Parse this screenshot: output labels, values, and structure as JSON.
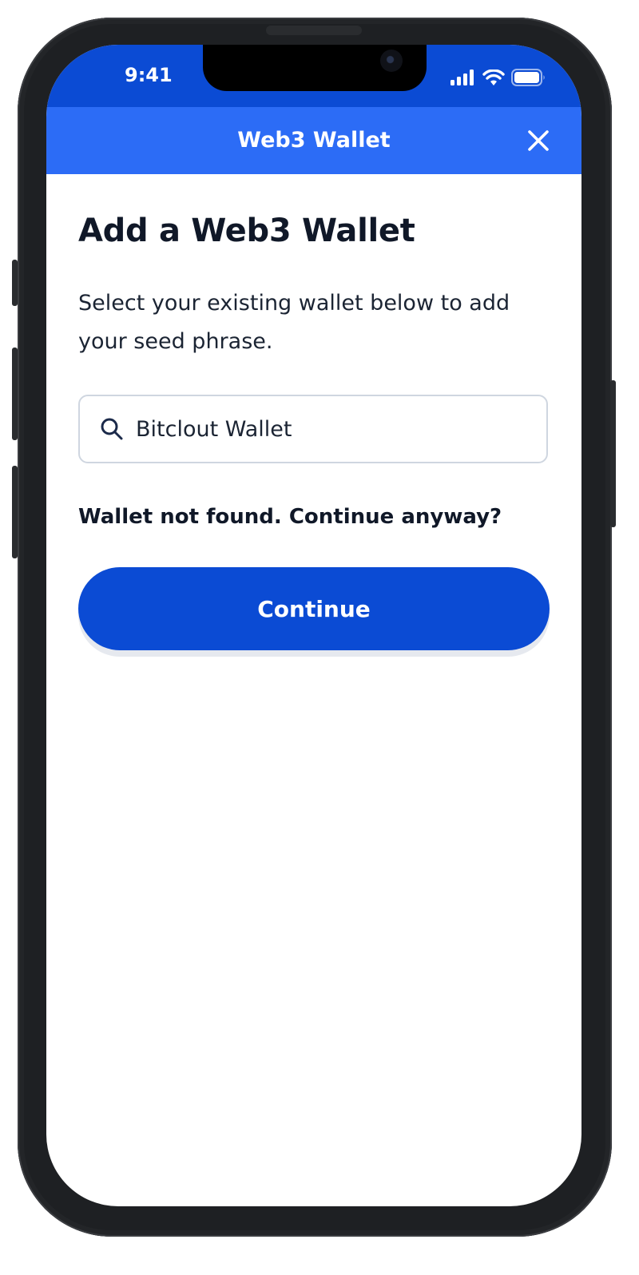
{
  "status_bar": {
    "time": "9:41",
    "icons": [
      "cellular-signal-icon",
      "wifi-icon",
      "battery-icon"
    ]
  },
  "header": {
    "title": "Web3 Wallet",
    "close_icon": "close-icon"
  },
  "main": {
    "heading": "Add a Web3 Wallet",
    "description": "Select your existing wallet below to add your seed phrase.",
    "search": {
      "icon": "search-icon",
      "value": "Bitclout Wallet",
      "placeholder": ""
    },
    "not_found_message": "Wallet not found. Continue anyway?",
    "continue_label": "Continue"
  },
  "colors": {
    "status_bar_bg": "#0b4bd4",
    "nav_bar_bg": "#2c6cf6",
    "primary_button": "#0b4bd4",
    "text_dark": "#101828"
  }
}
